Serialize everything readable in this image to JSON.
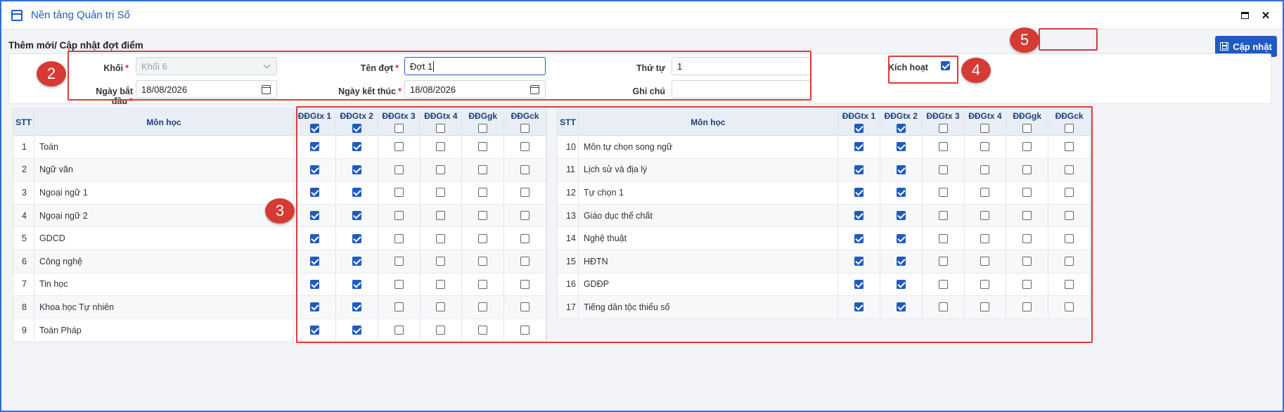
{
  "window": {
    "title": "Nền tảng Quản trị Số",
    "maximize_glyph": "",
    "close_glyph": "✕"
  },
  "page_title": "Thêm mới/ Cập nhật đợt điểm",
  "update_button": {
    "label": "Cập nhật",
    "icon": "save-icon"
  },
  "form": {
    "khoi": {
      "label": "Khối",
      "value": "Khối 6",
      "required": true
    },
    "ten_dot": {
      "label": "Tên đợt",
      "value": "Đợt 1",
      "required": true
    },
    "thu_tu": {
      "label": "Thứ tự",
      "value": "1"
    },
    "kich_hoat": {
      "label": "Kích hoạt",
      "checked": true
    },
    "ngay_bat_dau": {
      "label": "Ngày bắt đầu",
      "value": "18/08/2026",
      "required": true
    },
    "ngay_ket_thuc": {
      "label": "Ngày kết thúc",
      "value": "18/08/2026",
      "required": true
    },
    "ghi_chu": {
      "label": "Ghi chú",
      "value": ""
    },
    "required_mark": "*"
  },
  "table": {
    "headers": {
      "stt": "STT",
      "subject": "Môn học",
      "cols": [
        "ĐĐGtx 1",
        "ĐĐGtx 2",
        "ĐĐGtx 3",
        "ĐĐGtx 4",
        "ĐĐGgk",
        "ĐĐGck"
      ]
    },
    "header_checks": [
      true,
      true,
      false,
      false,
      false,
      false
    ],
    "left_rows": [
      {
        "stt": "1",
        "name": "Toán",
        "checks": [
          true,
          true,
          false,
          false,
          false,
          false
        ]
      },
      {
        "stt": "2",
        "name": "Ngữ văn",
        "checks": [
          true,
          true,
          false,
          false,
          false,
          false
        ]
      },
      {
        "stt": "3",
        "name": "Ngoại ngữ 1",
        "checks": [
          true,
          true,
          false,
          false,
          false,
          false
        ]
      },
      {
        "stt": "4",
        "name": "Ngoại ngữ 2",
        "checks": [
          true,
          true,
          false,
          false,
          false,
          false
        ]
      },
      {
        "stt": "5",
        "name": "GDCD",
        "checks": [
          true,
          true,
          false,
          false,
          false,
          false
        ]
      },
      {
        "stt": "6",
        "name": "Công nghệ",
        "checks": [
          true,
          true,
          false,
          false,
          false,
          false
        ]
      },
      {
        "stt": "7",
        "name": "Tin học",
        "checks": [
          true,
          true,
          false,
          false,
          false,
          false
        ]
      },
      {
        "stt": "8",
        "name": "Khoa học Tự nhiên",
        "checks": [
          true,
          true,
          false,
          false,
          false,
          false
        ]
      },
      {
        "stt": "9",
        "name": "Toán Pháp",
        "checks": [
          true,
          true,
          false,
          false,
          false,
          false
        ]
      }
    ],
    "right_rows": [
      {
        "stt": "10",
        "name": "Môn tự chọn song ngữ",
        "checks": [
          true,
          true,
          false,
          false,
          false,
          false
        ]
      },
      {
        "stt": "11",
        "name": "Lịch sử và địa lý",
        "checks": [
          true,
          true,
          false,
          false,
          false,
          false
        ]
      },
      {
        "stt": "12",
        "name": "Tự chọn 1",
        "checks": [
          true,
          true,
          false,
          false,
          false,
          false
        ]
      },
      {
        "stt": "13",
        "name": "Giáo dục thể chất",
        "checks": [
          true,
          true,
          false,
          false,
          false,
          false
        ]
      },
      {
        "stt": "14",
        "name": "Nghệ thuật",
        "checks": [
          true,
          true,
          false,
          false,
          false,
          false
        ]
      },
      {
        "stt": "15",
        "name": "HĐTN",
        "checks": [
          true,
          true,
          false,
          false,
          false,
          false
        ]
      },
      {
        "stt": "16",
        "name": "GDĐP",
        "checks": [
          true,
          true,
          false,
          false,
          false,
          false
        ]
      },
      {
        "stt": "17",
        "name": "Tiếng dân tộc thiểu số",
        "checks": [
          true,
          true,
          false,
          false,
          false,
          false
        ]
      }
    ]
  },
  "annotations": [
    "2",
    "3",
    "4",
    "5"
  ],
  "colors": {
    "accent": "#1f5bbf",
    "highlight": "#e03a3a",
    "badge": "#d63a34"
  }
}
